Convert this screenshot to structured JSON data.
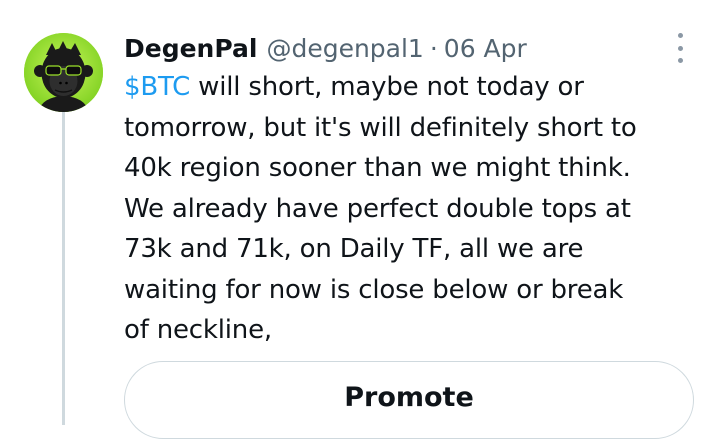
{
  "tweet": {
    "author": {
      "display_name": "DegenPal",
      "handle": "@degenpal1",
      "avatar_icon": "ape-with-glasses-avatar"
    },
    "separator": "·",
    "date": "06 Apr",
    "cashtag": "$BTC",
    "text_lines": [
      " will short, maybe not today or",
      "tomorrow, but it's will definitely short to",
      "40k region sooner than we might think.",
      "We already have perfect double tops at",
      "73k and 71k, on Daily TF, all we are",
      "waiting for now is close below or break",
      "of neckline,"
    ],
    "more_icon": "more-vertical-icon"
  },
  "actions": {
    "promote_label": "Promote"
  },
  "colors": {
    "link": "#1d9bf0",
    "secondary_text": "#536471",
    "border": "#cfd9de"
  }
}
